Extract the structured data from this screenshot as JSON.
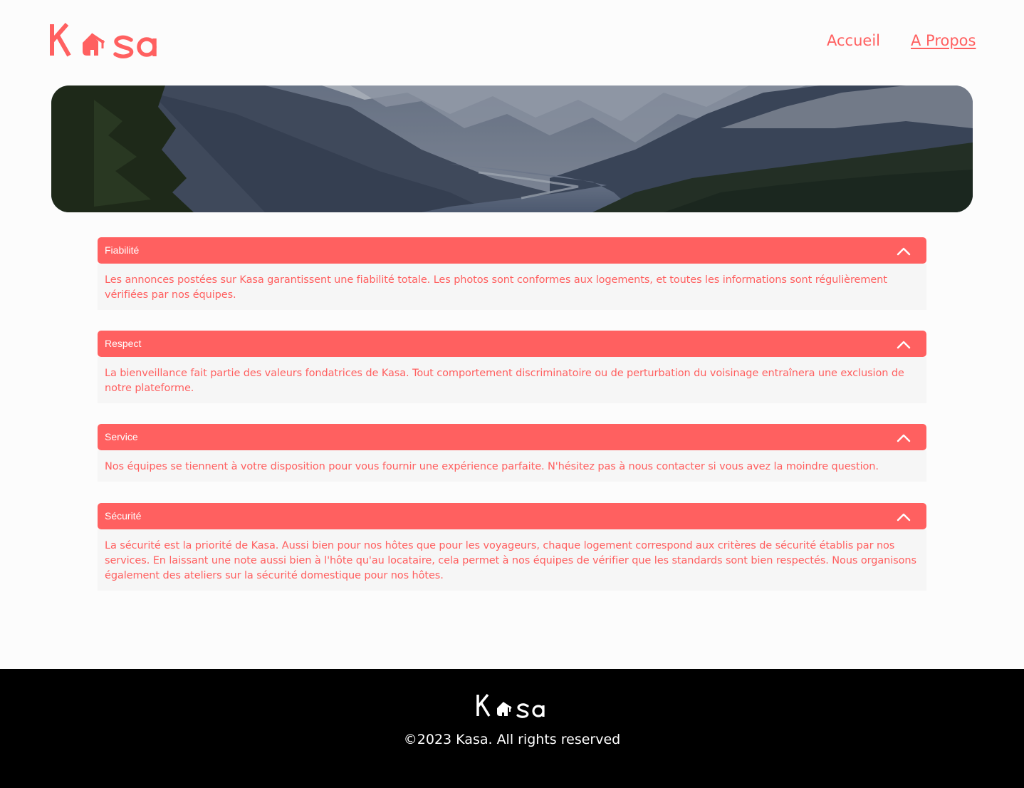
{
  "brand": {
    "name": "Kasa",
    "accent_color": "#ff6060",
    "footer_bg": "#000000"
  },
  "nav": {
    "items": [
      {
        "label": "Accueil",
        "active": false
      },
      {
        "label": "A Propos",
        "active": true
      }
    ]
  },
  "banner": {
    "image": "mountain-valley-landscape"
  },
  "collapses": [
    {
      "title": "Fiabilité",
      "icon": "chevron-up-icon",
      "content": "Les annonces postées sur Kasa garantissent une fiabilité totale. Les photos sont conformes aux logements, et toutes les informations sont régulièrement vérifiées par nos équipes."
    },
    {
      "title": "Respect",
      "icon": "chevron-up-icon",
      "content": "La bienveillance fait partie des valeurs fondatrices de Kasa. Tout comportement discriminatoire ou de perturbation du voisinage entraînera une exclusion de notre plateforme."
    },
    {
      "title": "Service",
      "icon": "chevron-up-icon",
      "content": "Nos équipes se tiennent à votre disposition pour vous fournir une expérience parfaite. N'hésitez pas à nous contacter si vous avez la moindre question."
    },
    {
      "title": "Sécurité",
      "icon": "chevron-up-icon",
      "content": "La sécurité est la priorité de Kasa. Aussi bien pour nos hôtes que pour les voyageurs, chaque logement correspond aux critères de sécurité établis par nos services. En laissant une note aussi bien à l'hôte qu'au locataire, cela permet à nos équipes de vérifier que les standards sont bien respectés. Nous organisons également des ateliers sur la sécurité domestique pour nos hôtes."
    }
  ],
  "footer": {
    "copyright": "©2023 Kasa. All rights reserved"
  }
}
